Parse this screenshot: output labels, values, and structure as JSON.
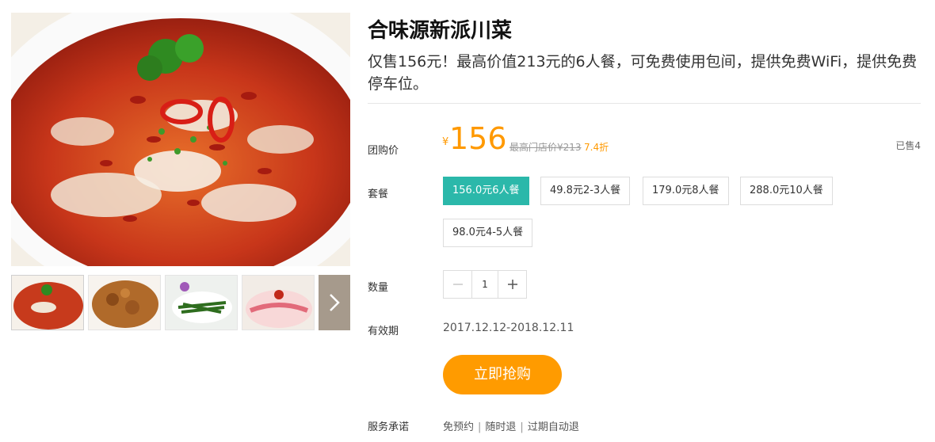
{
  "product": {
    "title": "合味源新派川菜",
    "description": "仅售156元！最高价值213元的6人餐，可免费使用包间，提供免费WiFi，提供免费停车位。"
  },
  "price": {
    "label": "团购价",
    "currency": "¥",
    "value": "156",
    "original": "最高门店价¥213",
    "discount": "7.4折",
    "sold": "已售4"
  },
  "packages": {
    "label": "套餐",
    "options": [
      "156.0元6人餐",
      "49.8元2-3人餐",
      "179.0元8人餐",
      "288.0元10人餐",
      "98.0元4-5人餐"
    ],
    "selected": "156.0元6人餐"
  },
  "quantity": {
    "label": "数量",
    "value": "1",
    "minus_icon": "minus-icon",
    "plus_icon": "plus-icon"
  },
  "validity": {
    "label": "有效期",
    "value": "2017.12.12-2018.12.11"
  },
  "buy_button": {
    "label": "立即抢购"
  },
  "service": {
    "label": "服务承诺",
    "items": [
      "免预约",
      "随时退",
      "过期自动退"
    ]
  },
  "gallery": {
    "thumbnails": [
      "fish-in-chili-oil",
      "fried-chicken",
      "green-beans",
      "noodle-dish",
      "restaurant-front"
    ],
    "next_icon": "chevron-right-icon"
  },
  "colors": {
    "accent": "#ff9900",
    "selected": "#2bb8aa",
    "buy": "#ff9b00"
  }
}
